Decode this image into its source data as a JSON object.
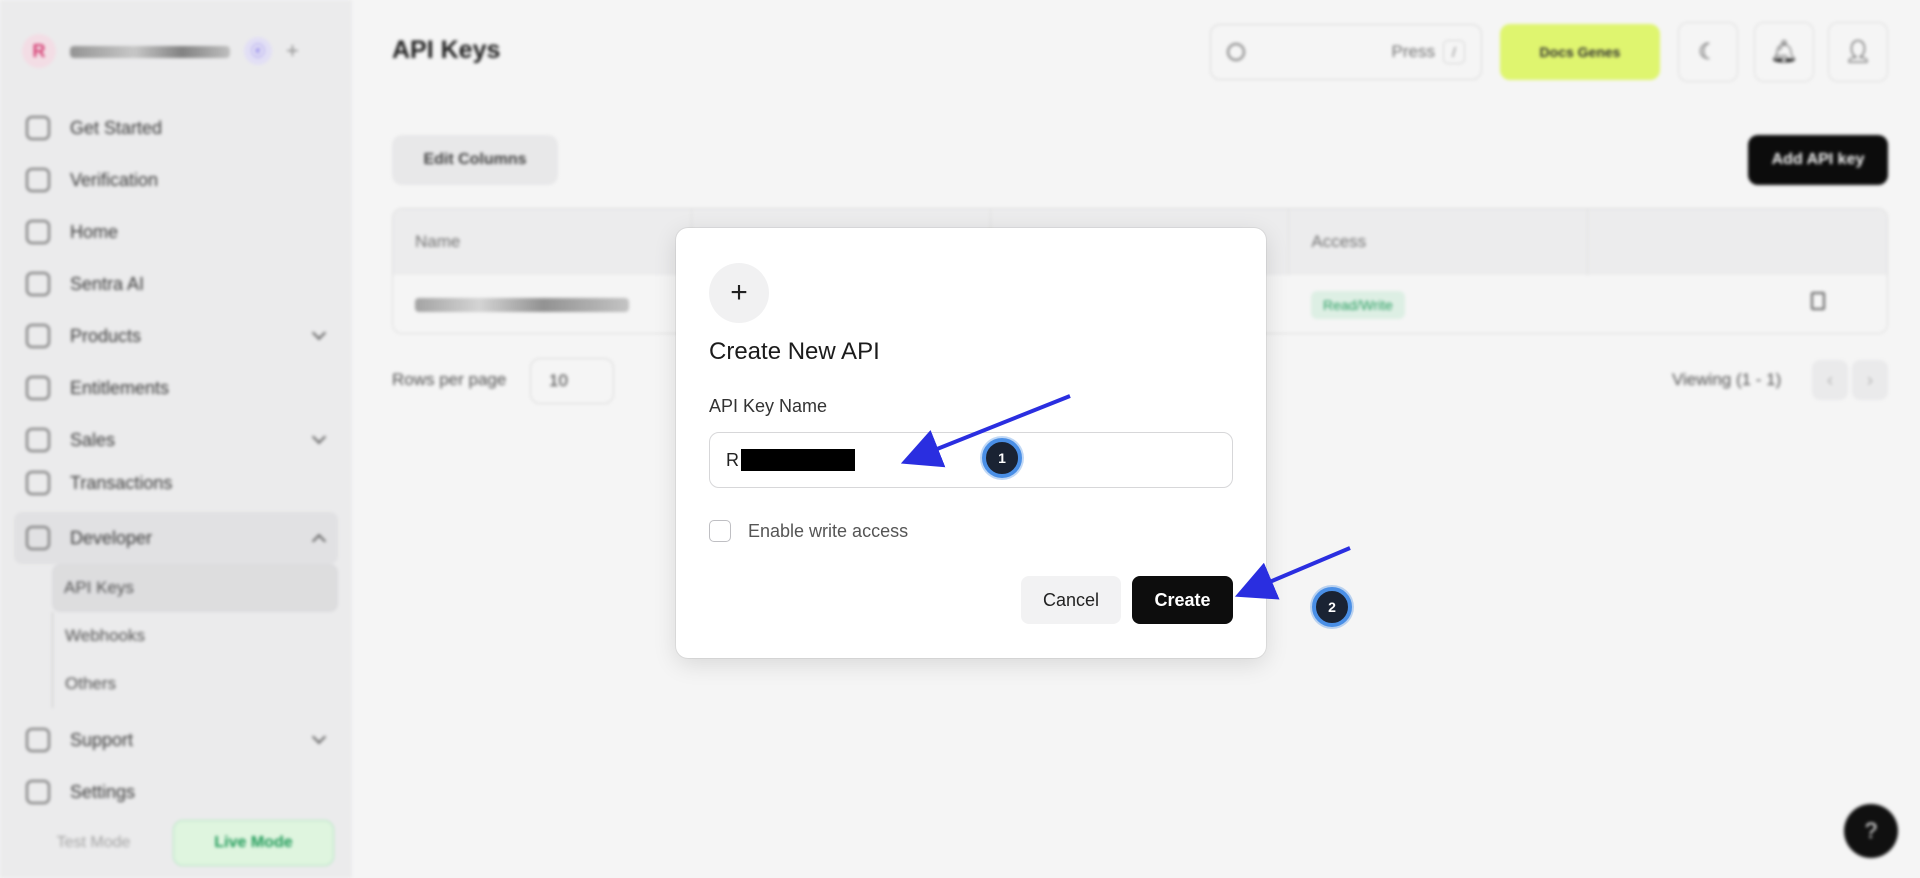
{
  "sidebar": {
    "org_initial": "R",
    "org_badge": "ⓔ",
    "items": [
      {
        "label": "Get Started"
      },
      {
        "label": "Verification"
      },
      {
        "label": "Home"
      },
      {
        "label": "Sentra AI"
      },
      {
        "label": "Products"
      },
      {
        "label": "Entitlements"
      },
      {
        "label": "Sales"
      },
      {
        "label": "Transactions"
      },
      {
        "label": "Developer"
      }
    ],
    "developer_sub": [
      {
        "label": "API Keys"
      },
      {
        "label": "Webhooks"
      },
      {
        "label": "Others"
      }
    ],
    "bottom_items": [
      {
        "label": "Support"
      },
      {
        "label": "Settings"
      }
    ],
    "mode_test": "Test Mode",
    "mode_live": "Live Mode"
  },
  "header": {
    "title": "API Keys",
    "search_press": "Press",
    "search_kbd": "/",
    "docs_label": "Docs Genes"
  },
  "toolbar": {
    "edit_columns": "Edit Columns",
    "add_api_key": "Add API key"
  },
  "table": {
    "columns": [
      "Name",
      "",
      "",
      "Access",
      ""
    ],
    "rows": [
      {
        "access": "Read/Write"
      }
    ]
  },
  "pagination": {
    "rows_per_page_label": "Rows per page",
    "rows_per_page_value": "10",
    "viewing": "Viewing (1 - 1)"
  },
  "help": "?",
  "modal": {
    "icon": "+",
    "title": "Create New API",
    "field_label": "API Key Name",
    "field_value_prefix": "R",
    "checkbox_label": "Enable write access",
    "cancel_label": "Cancel",
    "create_label": "Create"
  },
  "annotations": [
    {
      "number": "1"
    },
    {
      "number": "2"
    }
  ],
  "colors": {
    "accent_docs": "#e9ff74",
    "primary_button": "#0d0d0d",
    "annotation_arrow": "#2a2ee0",
    "annotation_marker_ring": "#4a8fe6"
  }
}
